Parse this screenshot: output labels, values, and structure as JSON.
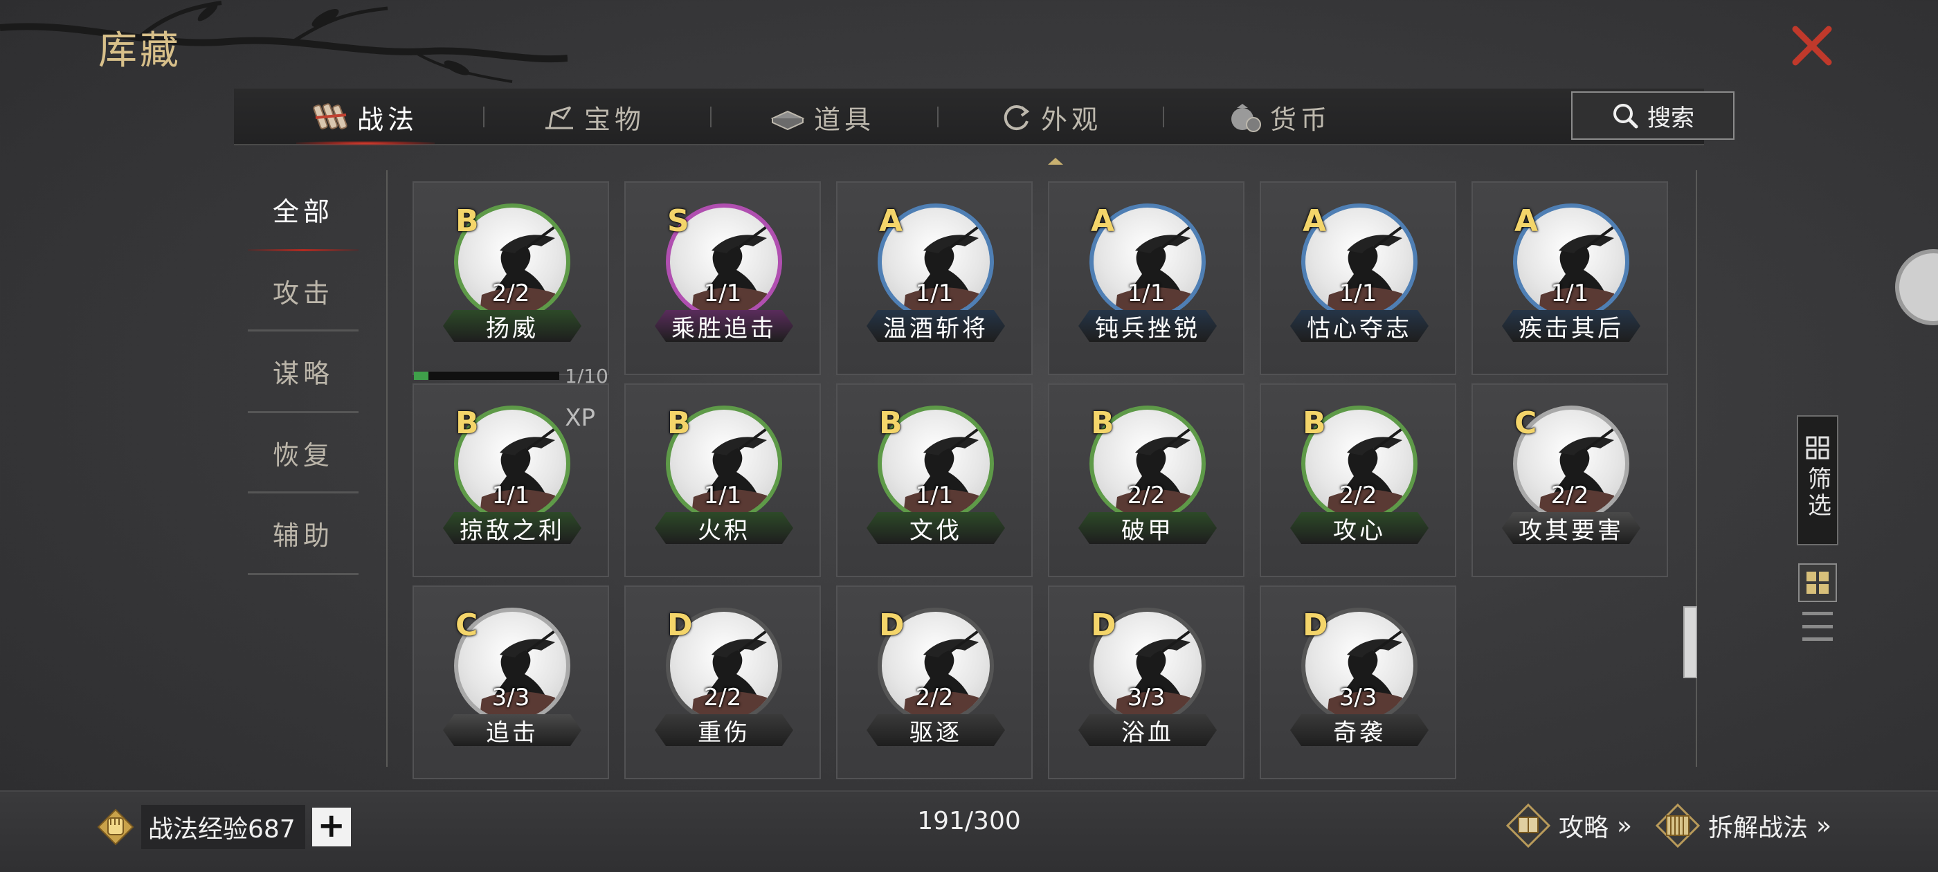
{
  "header": {
    "title": "库藏"
  },
  "tabs": [
    {
      "label": "战法",
      "icon": "strategy-scroll-icon",
      "active": true
    },
    {
      "label": "宝物",
      "icon": "treasure-icon",
      "active": false
    },
    {
      "label": "道具",
      "icon": "item-icon",
      "active": false
    },
    {
      "label": "外观",
      "icon": "appearance-icon",
      "active": false
    },
    {
      "label": "货币",
      "icon": "currency-bag-icon",
      "active": false
    }
  ],
  "search": {
    "label": "搜索"
  },
  "categories": [
    {
      "label": "全部",
      "active": true
    },
    {
      "label": "攻击",
      "active": false
    },
    {
      "label": "谋略",
      "active": false
    },
    {
      "label": "恢复",
      "active": false
    },
    {
      "label": "辅助",
      "active": false
    }
  ],
  "grade_colors": {
    "S": "#b04fb0",
    "A": "#4f7fb4",
    "B": "#5e9a48",
    "C": "#a8a8a8",
    "D": "#555555"
  },
  "name_bg": {
    "S": "#5a2c5c",
    "A": "#253548",
    "B": "#2d4a28",
    "C": "#4a4a4a",
    "D": "#3a3a3a"
  },
  "cards": [
    {
      "grade": "B",
      "count": "2/2",
      "name": "扬威",
      "progress": {
        "label": "1/10",
        "value": 0.1
      }
    },
    {
      "grade": "S",
      "count": "1/1",
      "name": "乘胜追击"
    },
    {
      "grade": "A",
      "count": "1/1",
      "name": "温酒斩将"
    },
    {
      "grade": "A",
      "count": "1/1",
      "name": "钝兵挫锐"
    },
    {
      "grade": "A",
      "count": "1/1",
      "name": "怙心夺志"
    },
    {
      "grade": "A",
      "count": "1/1",
      "name": "疾击其后"
    },
    {
      "grade": "B",
      "count": "1/1",
      "name": "掠敌之利",
      "xp": "XP"
    },
    {
      "grade": "B",
      "count": "1/1",
      "name": "火积"
    },
    {
      "grade": "B",
      "count": "1/1",
      "name": "文伐"
    },
    {
      "grade": "B",
      "count": "2/2",
      "name": "破甲"
    },
    {
      "grade": "B",
      "count": "2/2",
      "name": "攻心"
    },
    {
      "grade": "C",
      "count": "2/2",
      "name": "攻其要害"
    },
    {
      "grade": "C",
      "count": "3/3",
      "name": "追击"
    },
    {
      "grade": "D",
      "count": "2/2",
      "name": "重伤"
    },
    {
      "grade": "D",
      "count": "2/2",
      "name": "驱逐"
    },
    {
      "grade": "D",
      "count": "3/3",
      "name": "浴血"
    },
    {
      "grade": "D",
      "count": "3/3",
      "name": "奇袭"
    }
  ],
  "side_controls": {
    "filter_label": "筛选"
  },
  "footer": {
    "exp_label": "战法经验687",
    "plus": "+",
    "capacity": "191/300",
    "guide_label": "攻略",
    "dismantle_label": "拆解战法",
    "chevrons": "»"
  }
}
